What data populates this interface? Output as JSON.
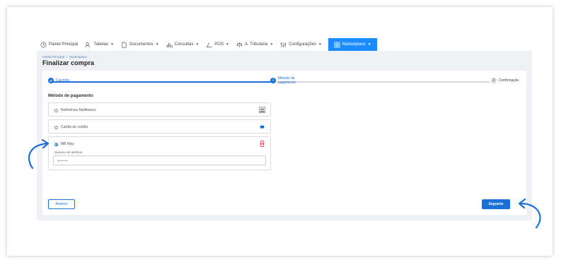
{
  "nav": {
    "items": [
      {
        "label": "Painel Principal",
        "icon": "clock-icon"
      },
      {
        "label": "Tabelas",
        "icon": "users-icon"
      },
      {
        "label": "Documentos",
        "icon": "document-icon"
      },
      {
        "label": "Consultas",
        "icon": "chart-icon"
      },
      {
        "label": "POS",
        "icon": "pos-icon"
      },
      {
        "label": "A. Tributária",
        "icon": "scale-icon"
      },
      {
        "label": "Configurações",
        "icon": "settings-icon"
      },
      {
        "label": "Marketplace",
        "icon": "marketplace-icon"
      }
    ],
    "active_color": "#1a8cff"
  },
  "breadcrumb": {
    "home": "Painel Principal",
    "separator": "/",
    "current": "Marketplace"
  },
  "page_title": "Finalizar compra",
  "stepper": {
    "steps": [
      {
        "number": "",
        "label": "Carrinho",
        "state": "done"
      },
      {
        "number": "1",
        "label": "Método de pagamento",
        "state": "active"
      },
      {
        "number": "2",
        "label": "Confirmação",
        "state": "pending"
      }
    ]
  },
  "payment": {
    "section_title": "Método de pagamento",
    "options": [
      {
        "label": "Referência Multibanco",
        "selected": false,
        "icon": "multibanco-icon"
      },
      {
        "label": "Cartão de crédito",
        "selected": false,
        "icon": "credit-card-icon"
      },
      {
        "label": "MB Way",
        "selected": true,
        "icon": "mbway-icon"
      }
    ],
    "phone_label": "Número de telefone",
    "phone_value": "9••••••••"
  },
  "buttons": {
    "back": "Anterior",
    "next": "Seguinte"
  },
  "colors": {
    "primary": "#1a6fd8",
    "arrow": "#1a6fd8"
  }
}
